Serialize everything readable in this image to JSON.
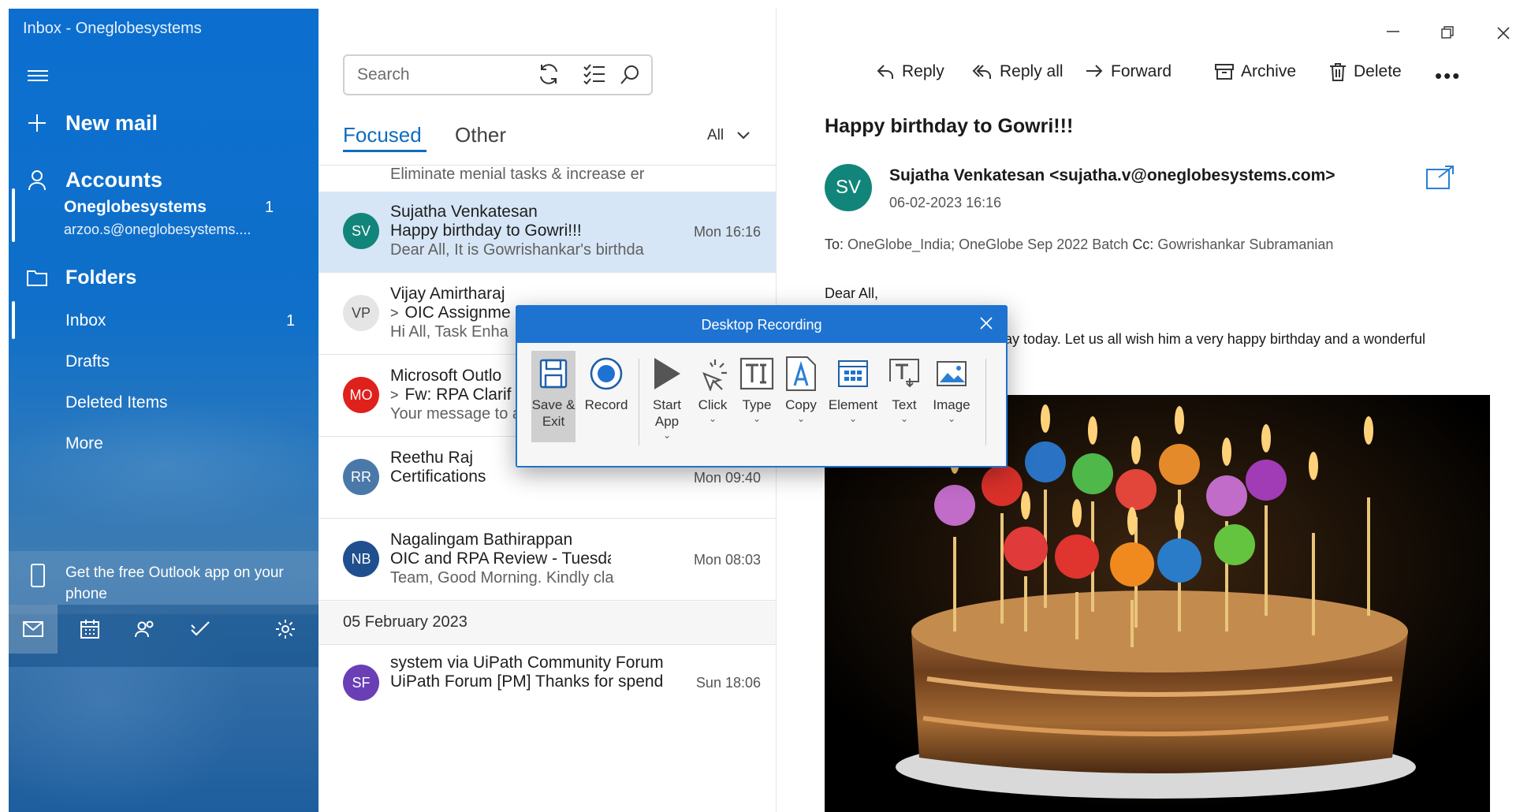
{
  "window": {
    "title": "Inbox - Oneglobesystems"
  },
  "nav": {
    "new_mail": "New mail",
    "accounts": "Accounts",
    "account_name": "Oneglobesystems",
    "account_count": "1",
    "account_email": "arzoo.s@oneglobesystems....",
    "folders": "Folders",
    "folder_items": [
      {
        "label": "Inbox",
        "count": "1"
      },
      {
        "label": "Drafts",
        "count": ""
      },
      {
        "label": "Deleted Items",
        "count": ""
      },
      {
        "label": "More",
        "count": ""
      }
    ],
    "promo": "Get the free Outlook app on your phone"
  },
  "list": {
    "search_placeholder": "Search",
    "tab_focused": "Focused",
    "tab_other": "Other",
    "filter": "All",
    "top_preview": "Eliminate menial tasks & increase er",
    "messages": [
      {
        "initials": "SV",
        "color": "#12857a",
        "sender": "Sujatha Venkatesan",
        "subject": "Happy birthday to Gowri!!!",
        "time": "Mon 16:16",
        "preview": "Dear All, It is Gowrishankar's birthda"
      },
      {
        "initials": "VP",
        "color": "#e8e8e8",
        "sender": "Vijay Amirtharaj",
        "subject": "OIC Assignme",
        "time": "",
        "preview": "Hi All, Task Enha"
      },
      {
        "initials": "MO",
        "color": "#e0201c",
        "sender": "Microsoft Outlo",
        "subject": "Fw: RPA Clarif",
        "time": "",
        "preview": "Your message to arzoosah23@gmai"
      },
      {
        "initials": "RR",
        "color": "#4a78a8",
        "sender": "Reethu Raj",
        "subject": "Certifications",
        "time": "Mon 09:40",
        "preview": ""
      },
      {
        "initials": "NB",
        "color": "#1f4f8e",
        "sender": "Nagalingam Bathirappan",
        "subject": "OIC and RPA Review - Tuesday and",
        "time": "Mon 08:03",
        "preview": "Team, Good Morning. Kindly clarify ."
      }
    ],
    "date_header": "05 February 2023",
    "last_message": {
      "initials": "SF",
      "color": "#6a3fb5",
      "sender": "system via UiPath Community Forum",
      "subject": "UiPath Forum [PM] Thanks for spend",
      "time": "Sun 18:06"
    }
  },
  "reading": {
    "actions": {
      "reply": "Reply",
      "reply_all": "Reply all",
      "forward": "Forward",
      "archive": "Archive",
      "delete": "Delete"
    },
    "subject": "Happy birthday to Gowri!!!",
    "avatar": "SV",
    "from": "Sujatha Venkatesan <sujatha.v@oneglobesystems.com>",
    "date": "06-02-2023 16:16",
    "to_label": "To:",
    "to": "OneGlobe_India; OneGlobe Sep 2022 Batch",
    "cc_label": "Cc:",
    "cc": "Gowrishankar Subramanian",
    "greeting": "Dear All,",
    "body_visible": "day today. Let us all wish him a very happy birthday and a wonderful"
  },
  "dialog": {
    "title": "Desktop Recording",
    "tools": {
      "save": "Save & Exit",
      "record": "Record",
      "start_app": "Start App",
      "click": "Click",
      "type": "Type",
      "copy": "Copy",
      "element": "Element",
      "text": "Text",
      "image": "Image"
    }
  }
}
